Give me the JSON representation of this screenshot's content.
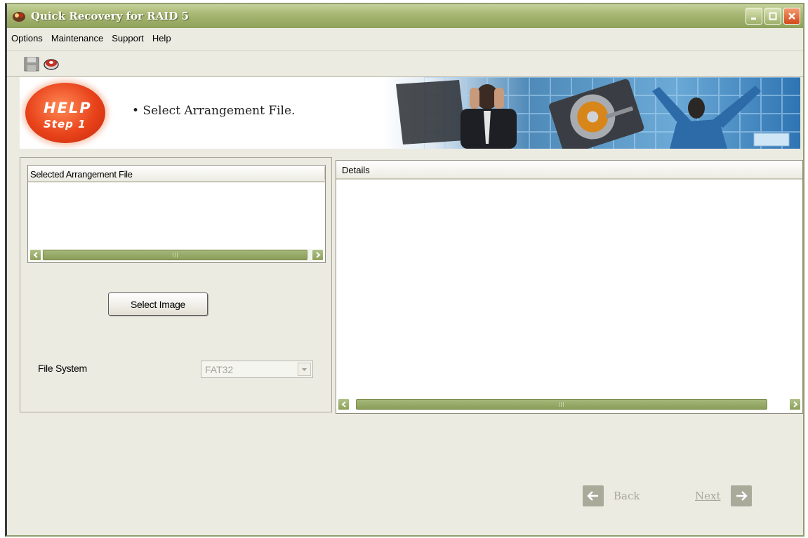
{
  "window": {
    "title": "Quick Recovery for RAID 5"
  },
  "menu": [
    "Options",
    "Maintenance",
    "Support",
    "Help"
  ],
  "toolbar": {
    "icons": [
      "save-icon",
      "recovery-disk-icon"
    ]
  },
  "banner": {
    "help_title": "HELP",
    "help_step": "Step 1",
    "instruction": "• Select Arrangement File."
  },
  "left_panel": {
    "list_header": "Selected Arrangement File",
    "select_image_label": "Select Image",
    "file_system_label": "File System",
    "file_system_value": "FAT32"
  },
  "right_panel": {
    "details_header": "Details"
  },
  "navigation": {
    "back_label": "Back",
    "next_label": "Next"
  },
  "colors": {
    "titlebar": "#a8b874",
    "window_bg": "#ecebe2",
    "help_badge": "#e8421a",
    "scrollbar": "#8ea15a"
  }
}
